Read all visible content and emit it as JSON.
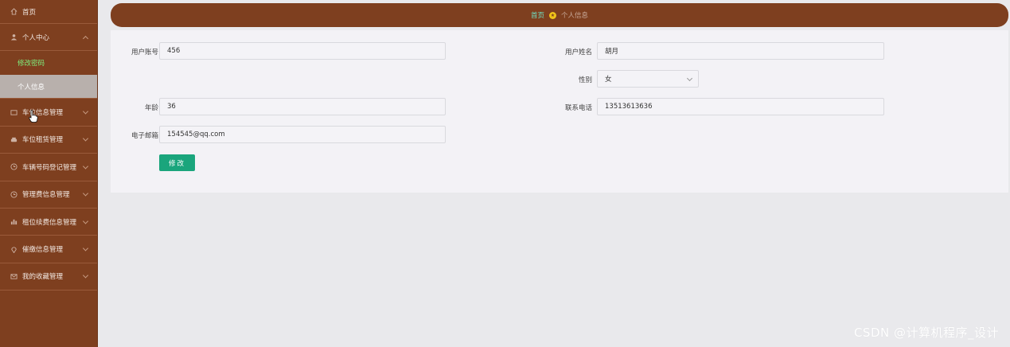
{
  "sidebar": {
    "home_label": "首页",
    "personal_center_label": "个人中心",
    "sub_items": [
      {
        "label": "修改密码"
      },
      {
        "label": "个人信息"
      }
    ],
    "items": [
      {
        "label": "车位信息管理",
        "icon": "grid-icon"
      },
      {
        "label": "车位租赁管理",
        "icon": "car-icon"
      },
      {
        "label": "车辆号码登记管理",
        "icon": "clock-icon"
      },
      {
        "label": "管理费信息管理",
        "icon": "clock-icon"
      },
      {
        "label": "租位续费信息管理",
        "icon": "bar-chart-icon"
      },
      {
        "label": "催缴信息管理",
        "icon": "location-icon"
      },
      {
        "label": "我的收藏管理",
        "icon": "mail-icon"
      }
    ]
  },
  "breadcrumb": {
    "home": "首页",
    "current": "个人信息"
  },
  "form": {
    "account_label": "用户账号",
    "account_value": "456",
    "name_label": "用户姓名",
    "name_value": "胡月",
    "gender_label": "性别",
    "gender_value": "女",
    "age_label": "年龄",
    "age_value": "36",
    "phone_label": "联系电话",
    "phone_value": "13513613636",
    "email_label": "电子邮箱",
    "email_value": "154545@qq.com",
    "submit_label": "修改"
  },
  "watermark": "CSDN @计算机程序_设计",
  "colors": {
    "sidebar_bg": "#7e3f1f",
    "button": "#1aa57c",
    "active_sub": "#7ef07e"
  }
}
